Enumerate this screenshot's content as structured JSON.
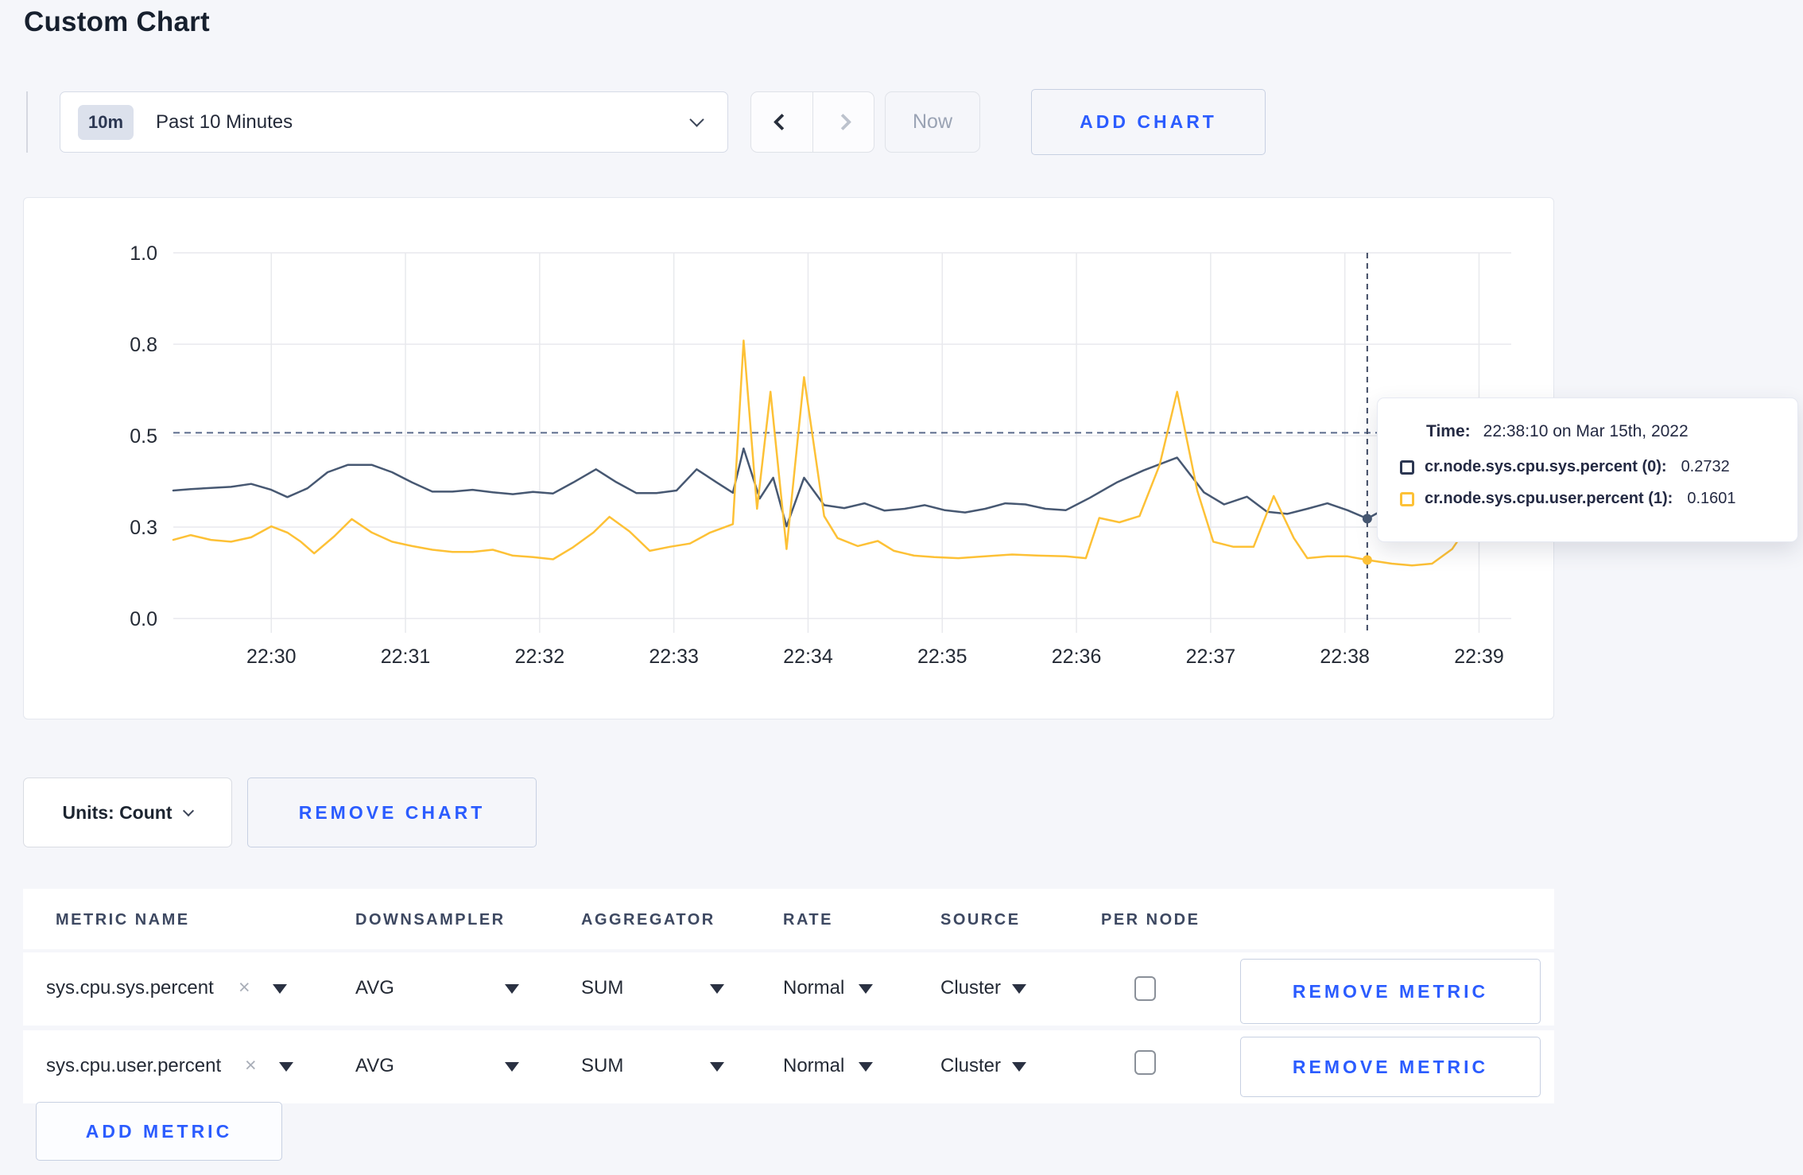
{
  "page": {
    "title": "Custom Chart",
    "background": "#f5f6fa",
    "accent_blue": "#2b5cff"
  },
  "toolbar": {
    "range_badge": "10m",
    "range_label": "Past 10 Minutes",
    "now_label": "Now",
    "add_chart_label": "ADD CHART"
  },
  "tooltip": {
    "time_label": "Time:",
    "time_value": "22:38:10 on Mar 15th, 2022",
    "series": [
      {
        "label": "cr.node.sys.cpu.sys.percent (0):",
        "value": "0.2732",
        "color": "#2c3752"
      },
      {
        "label": "cr.node.sys.cpu.user.percent (1):",
        "value": "0.1601",
        "color": "#fdc136"
      }
    ]
  },
  "units_bar": {
    "units_label": "Units: Count",
    "remove_chart_label": "REMOVE CHART"
  },
  "metrics_table": {
    "headers": [
      "METRIC NAME",
      "DOWNSAMPLER",
      "AGGREGATOR",
      "RATE",
      "SOURCE",
      "PER NODE"
    ],
    "rows": [
      {
        "metric": "sys.cpu.sys.percent",
        "downsampler": "AVG",
        "aggregator": "SUM",
        "rate": "Normal",
        "source": "Cluster",
        "per_node_checked": false,
        "remove_label": "REMOVE METRIC"
      },
      {
        "metric": "sys.cpu.user.percent",
        "downsampler": "AVG",
        "aggregator": "SUM",
        "rate": "Normal",
        "source": "Cluster",
        "per_node_checked": false,
        "remove_label": "REMOVE METRIC"
      }
    ],
    "add_metric_label": "ADD METRIC"
  },
  "chart_data": {
    "type": "line",
    "title": "",
    "xlabel": "",
    "ylabel": "",
    "x_axis": {
      "unit": "minutes after 22:29 on Mar 15th, 2022",
      "domain": [
        0.27,
        10.24
      ],
      "ticks": [
        1,
        2,
        3,
        4,
        5,
        6,
        7,
        8,
        9,
        10
      ],
      "tick_labels": [
        "22:30",
        "22:31",
        "22:32",
        "22:33",
        "22:34",
        "22:35",
        "22:36",
        "22:37",
        "22:38",
        "22:39"
      ]
    },
    "y_axis": {
      "range": [
        0,
        1
      ],
      "ticks": [
        0,
        0.25,
        0.5,
        0.75,
        1.0
      ],
      "tick_labels": [
        "0.0",
        "0.3",
        "0.5",
        "0.8",
        "1.0"
      ]
    },
    "grid": true,
    "legend_position": "tooltip",
    "guideline_value": 0.508,
    "crosshair": {
      "t": 9.167,
      "time": "22:38:10",
      "values": [
        0.2732,
        0.1601
      ]
    },
    "series": [
      {
        "name": "cr.node.sys.cpu.sys.percent (0)",
        "color": "#475872",
        "points": [
          [
            0.27,
            0.35
          ],
          [
            0.4,
            0.354
          ],
          [
            0.55,
            0.357
          ],
          [
            0.7,
            0.36
          ],
          [
            0.85,
            0.368
          ],
          [
            1.0,
            0.352
          ],
          [
            1.12,
            0.332
          ],
          [
            1.27,
            0.356
          ],
          [
            1.42,
            0.4
          ],
          [
            1.57,
            0.42
          ],
          [
            1.75,
            0.42
          ],
          [
            1.9,
            0.4
          ],
          [
            2.05,
            0.372
          ],
          [
            2.2,
            0.347
          ],
          [
            2.35,
            0.347
          ],
          [
            2.5,
            0.352
          ],
          [
            2.65,
            0.345
          ],
          [
            2.8,
            0.34
          ],
          [
            2.95,
            0.346
          ],
          [
            3.1,
            0.342
          ],
          [
            3.25,
            0.372
          ],
          [
            3.42,
            0.408
          ],
          [
            3.57,
            0.373
          ],
          [
            3.72,
            0.343
          ],
          [
            3.87,
            0.343
          ],
          [
            4.02,
            0.35
          ],
          [
            4.17,
            0.408
          ],
          [
            4.32,
            0.372
          ],
          [
            4.44,
            0.344
          ],
          [
            4.52,
            0.465
          ],
          [
            4.64,
            0.328
          ],
          [
            4.74,
            0.385
          ],
          [
            4.84,
            0.252
          ],
          [
            4.97,
            0.385
          ],
          [
            5.12,
            0.31
          ],
          [
            5.27,
            0.302
          ],
          [
            5.42,
            0.315
          ],
          [
            5.57,
            0.295
          ],
          [
            5.72,
            0.3
          ],
          [
            5.87,
            0.31
          ],
          [
            6.02,
            0.296
          ],
          [
            6.17,
            0.29
          ],
          [
            6.32,
            0.3
          ],
          [
            6.47,
            0.315
          ],
          [
            6.62,
            0.312
          ],
          [
            6.77,
            0.3
          ],
          [
            6.92,
            0.296
          ],
          [
            7.1,
            0.33
          ],
          [
            7.3,
            0.372
          ],
          [
            7.5,
            0.405
          ],
          [
            7.75,
            0.44
          ],
          [
            7.95,
            0.345
          ],
          [
            8.1,
            0.312
          ],
          [
            8.27,
            0.333
          ],
          [
            8.42,
            0.292
          ],
          [
            8.57,
            0.286
          ],
          [
            8.72,
            0.3
          ],
          [
            8.87,
            0.315
          ],
          [
            9.02,
            0.296
          ],
          [
            9.167,
            0.273
          ],
          [
            9.35,
            0.31
          ],
          [
            9.5,
            0.345
          ],
          [
            9.65,
            0.313
          ],
          [
            9.8,
            0.33
          ],
          [
            9.95,
            0.35
          ],
          [
            10.1,
            0.306
          ],
          [
            10.24,
            0.32
          ]
        ]
      },
      {
        "name": "cr.node.sys.cpu.user.percent (1)",
        "color": "#fdc136",
        "points": [
          [
            0.27,
            0.215
          ],
          [
            0.4,
            0.228
          ],
          [
            0.55,
            0.215
          ],
          [
            0.7,
            0.21
          ],
          [
            0.85,
            0.222
          ],
          [
            1.0,
            0.252
          ],
          [
            1.12,
            0.235
          ],
          [
            1.22,
            0.21
          ],
          [
            1.32,
            0.178
          ],
          [
            1.47,
            0.225
          ],
          [
            1.6,
            0.272
          ],
          [
            1.75,
            0.235
          ],
          [
            1.9,
            0.21
          ],
          [
            2.05,
            0.198
          ],
          [
            2.2,
            0.188
          ],
          [
            2.35,
            0.182
          ],
          [
            2.5,
            0.182
          ],
          [
            2.65,
            0.188
          ],
          [
            2.8,
            0.172
          ],
          [
            2.95,
            0.168
          ],
          [
            3.1,
            0.162
          ],
          [
            3.25,
            0.195
          ],
          [
            3.4,
            0.235
          ],
          [
            3.52,
            0.278
          ],
          [
            3.67,
            0.238
          ],
          [
            3.82,
            0.185
          ],
          [
            3.97,
            0.196
          ],
          [
            4.12,
            0.205
          ],
          [
            4.27,
            0.235
          ],
          [
            4.44,
            0.258
          ],
          [
            4.52,
            0.76
          ],
          [
            4.62,
            0.3
          ],
          [
            4.72,
            0.62
          ],
          [
            4.84,
            0.19
          ],
          [
            4.97,
            0.66
          ],
          [
            5.12,
            0.28
          ],
          [
            5.22,
            0.22
          ],
          [
            5.37,
            0.198
          ],
          [
            5.52,
            0.212
          ],
          [
            5.64,
            0.185
          ],
          [
            5.79,
            0.172
          ],
          [
            5.94,
            0.168
          ],
          [
            6.12,
            0.165
          ],
          [
            6.32,
            0.17
          ],
          [
            6.52,
            0.175
          ],
          [
            6.72,
            0.172
          ],
          [
            6.92,
            0.17
          ],
          [
            7.07,
            0.165
          ],
          [
            7.17,
            0.275
          ],
          [
            7.32,
            0.263
          ],
          [
            7.47,
            0.28
          ],
          [
            7.62,
            0.42
          ],
          [
            7.75,
            0.62
          ],
          [
            7.9,
            0.35
          ],
          [
            8.02,
            0.21
          ],
          [
            8.17,
            0.196
          ],
          [
            8.32,
            0.196
          ],
          [
            8.47,
            0.335
          ],
          [
            8.62,
            0.22
          ],
          [
            8.72,
            0.165
          ],
          [
            8.87,
            0.17
          ],
          [
            9.02,
            0.17
          ],
          [
            9.167,
            0.16
          ],
          [
            9.35,
            0.15
          ],
          [
            9.5,
            0.145
          ],
          [
            9.65,
            0.15
          ],
          [
            9.8,
            0.19
          ],
          [
            9.95,
            0.27
          ],
          [
            10.1,
            0.245
          ],
          [
            10.24,
            0.258
          ]
        ]
      }
    ]
  }
}
